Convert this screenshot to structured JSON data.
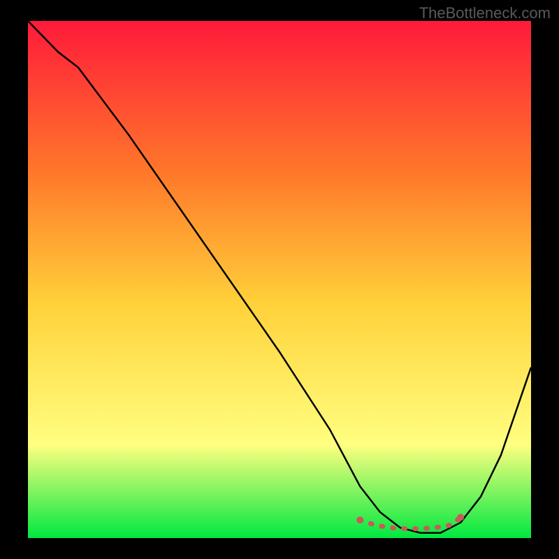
{
  "watermark": "TheBottleneck.com",
  "chart_data": {
    "type": "line",
    "title": "",
    "xlabel": "",
    "ylabel": "",
    "xlim": [
      0,
      100
    ],
    "ylim": [
      0,
      100
    ],
    "gradient": {
      "top": "#ff1a3a",
      "upper_mid": "#ff7a2a",
      "mid": "#ffd23a",
      "lower_mid": "#ffff80",
      "bottom": "#00e840"
    },
    "series": [
      {
        "name": "bottleneck-curve",
        "color": "#000000",
        "x": [
          0,
          6,
          10,
          20,
          30,
          40,
          50,
          60,
          66,
          70,
          74,
          78,
          82,
          86,
          90,
          94,
          100
        ],
        "y": [
          100,
          94,
          91,
          78,
          64,
          50,
          36,
          21,
          10,
          5,
          2,
          1,
          1,
          3,
          8,
          16,
          33
        ]
      }
    ],
    "markers": {
      "name": "optimal-range",
      "color": "#c85a5a",
      "x": [
        66,
        69,
        72,
        75,
        78,
        81,
        84,
        86
      ],
      "y": [
        3.5,
        2.5,
        2,
        1.8,
        1.8,
        2,
        2.5,
        4
      ]
    }
  }
}
